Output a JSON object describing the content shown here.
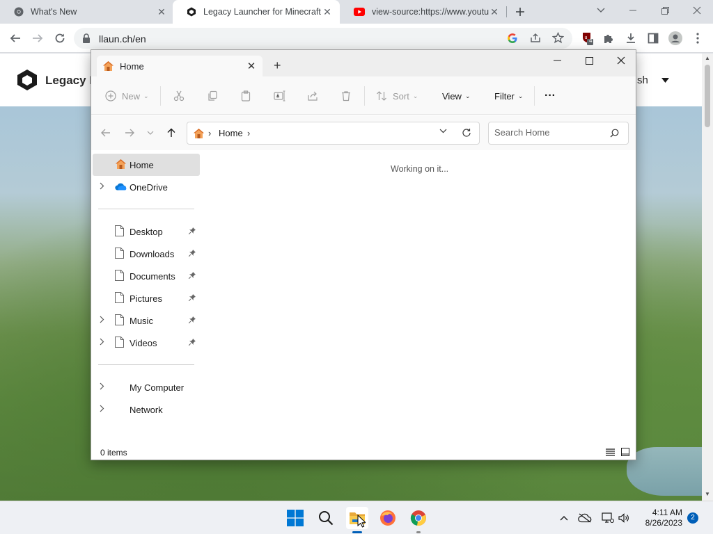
{
  "browser": {
    "tabs": [
      {
        "title": "What's New",
        "icon": "chrome-icon"
      },
      {
        "title": "Legacy Launcher for Minecraft",
        "icon": "legacy-launcher-icon",
        "active": true
      },
      {
        "title": "view-source:https://www.youtube",
        "icon": "youtube-icon"
      }
    ],
    "tab_close": "✕",
    "new_tab": "+",
    "url": "llaun.ch/en",
    "extension_badge": "4"
  },
  "website": {
    "name": "Legacy La",
    "language": "glish"
  },
  "explorer": {
    "tab_title": "Home",
    "tab_close": "✕",
    "new_tab": "+",
    "commands": {
      "new": "New",
      "sort": "Sort",
      "view": "View",
      "filter": "Filter",
      "more": "···"
    },
    "breadcrumb": [
      "Home"
    ],
    "search_placeholder": "Search Home",
    "nav": {
      "home": "Home",
      "onedrive": "OneDrive",
      "quick_access": [
        {
          "label": "Desktop",
          "pinned": true,
          "expandable": false
        },
        {
          "label": "Downloads",
          "pinned": true,
          "expandable": false
        },
        {
          "label": "Documents",
          "pinned": true,
          "expandable": false
        },
        {
          "label": "Pictures",
          "pinned": true,
          "expandable": false
        },
        {
          "label": "Music",
          "pinned": true,
          "expandable": true
        },
        {
          "label": "Videos",
          "pinned": true,
          "expandable": true
        }
      ],
      "my_computer": "My Computer",
      "network": "Network"
    },
    "content_message": "Working on it...",
    "status_count": "0 items"
  },
  "taskbar": {
    "time": "4:11 AM",
    "date": "8/26/2023",
    "notification_count": "2",
    "apps": [
      "start-icon",
      "search-icon",
      "file-explorer-icon",
      "firefox-icon",
      "chrome-icon"
    ]
  },
  "colors": {
    "accent": "#005fb8",
    "folder_home": "#e8883a",
    "onedrive": "#0a78d4"
  }
}
